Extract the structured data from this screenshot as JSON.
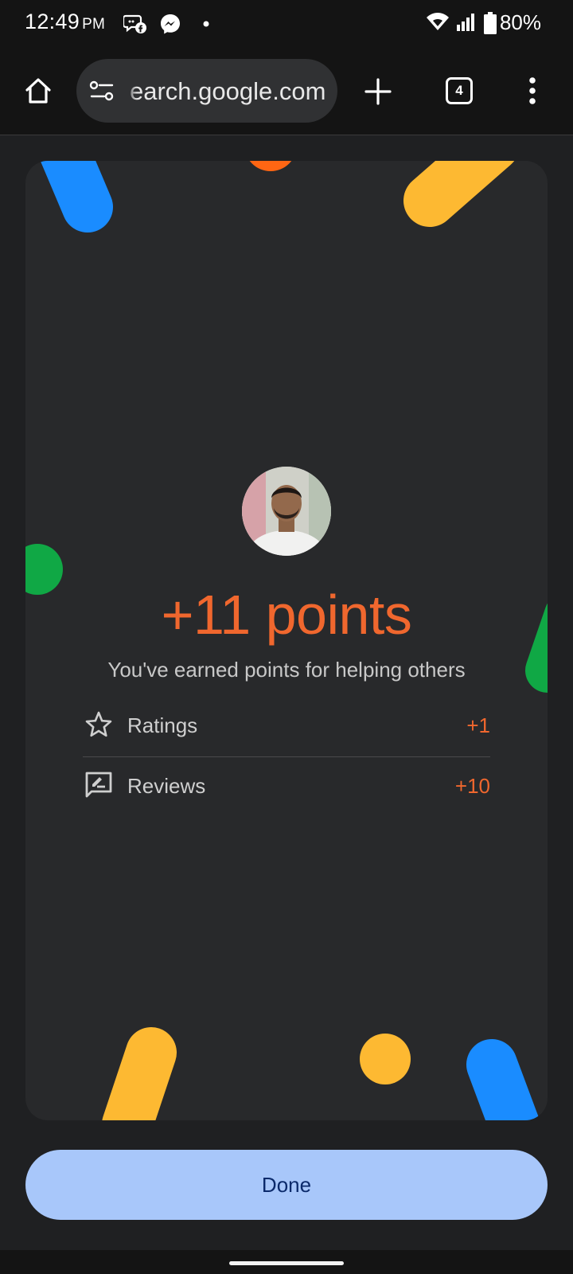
{
  "status_bar": {
    "time": "12:49",
    "ampm": "PM",
    "battery": "80%"
  },
  "browser": {
    "url": "earch.google.com",
    "tab_count": "4"
  },
  "card": {
    "points_title": "+11 points",
    "subtitle": "You've earned points for helping others",
    "rows": [
      {
        "icon": "star-outline-icon",
        "label": "Ratings",
        "value": "+1"
      },
      {
        "icon": "review-edit-icon",
        "label": "Reviews",
        "value": "+10"
      }
    ]
  },
  "done_button": {
    "label": "Done"
  },
  "colors": {
    "accent_orange": "#f0672e",
    "button_blue": "#a8c7fa",
    "button_text": "#0b2a6b",
    "confetti_blue": "#1a8cff",
    "confetti_yellow": "#fdb932",
    "confetti_green": "#10a845",
    "confetti_orange": "#ff6613"
  }
}
